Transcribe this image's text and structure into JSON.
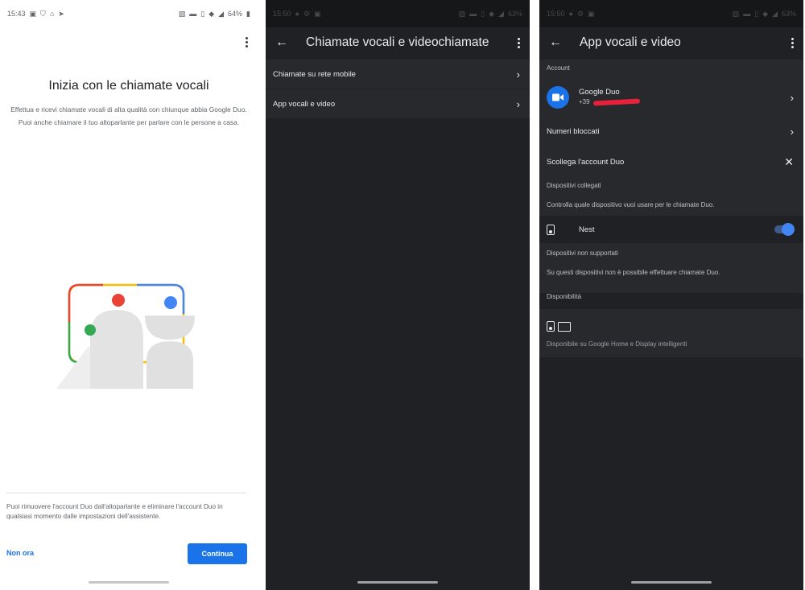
{
  "p1": {
    "status": {
      "time": "15:43",
      "battery": "64%"
    },
    "title": "Inizia con le chiamate vocali",
    "desc": "Effettua e ricevi chiamate vocali di alta qualità con chiunque abbia Google Duo. Puoi anche chiamare il tuo altoparlante per parlare con le persone a casa.",
    "footer": "Puoi rimuovere l'account Duo dall'altoparlante e eliminare l'account Duo in qualsiasi momento dalle impostazioni dell'assistente.",
    "not_now": "Non ora",
    "continue": "Continua"
  },
  "p2": {
    "status": {
      "time": "15:50",
      "battery": "63%"
    },
    "title": "Chiamate vocali e videochiamate",
    "items": [
      {
        "label": "Chiamate su rete mobile"
      },
      {
        "label": "App vocali e video"
      }
    ]
  },
  "p3": {
    "status": {
      "time": "15:50",
      "battery": "63%"
    },
    "title": "App vocali e video",
    "account_label": "Account",
    "account_name": "Google Duo",
    "account_number": "+39",
    "blocked": "Numeri bloccati",
    "unlink": "Scollega l'account Duo",
    "linked_label": "Dispositivi collegati",
    "linked_desc": "Controlla quale dispositivo vuoi usare per le chiamate Duo.",
    "device_name": "Nest",
    "unsupported_label": "Dispositivi non supportati",
    "unsupported_desc": "Su questi dispositivi non è possibile effettuare chiamate Duo.",
    "availability_label": "Disponibilità",
    "availability_desc": "Disponibile su Google Home e Display intelligenti"
  },
  "colors": {
    "accent": "#1a73e8",
    "toggle": "#4285f4",
    "red": "#ea4335",
    "green": "#34a853",
    "yellow": "#fbbc04",
    "dark_bg": "#202124",
    "band_bg": "#27292c"
  }
}
